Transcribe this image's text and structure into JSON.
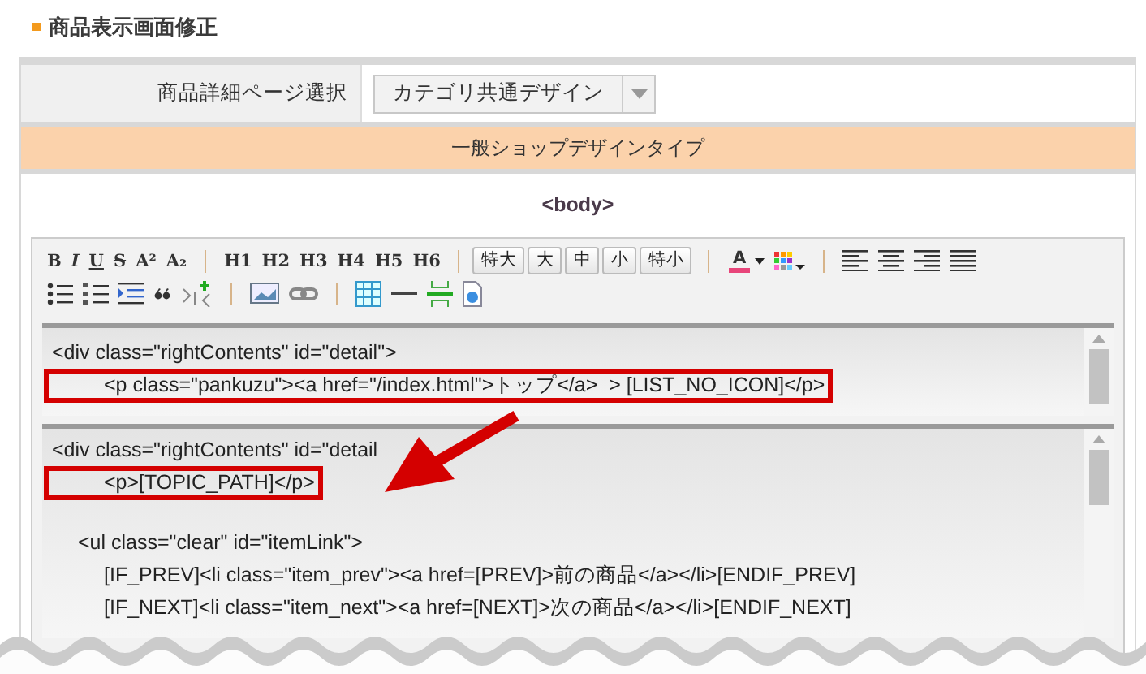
{
  "page_title": "商品表示画面修正",
  "detail_select": {
    "label": "商品詳細ページ選択",
    "value": "カテゴリ共通デザイン"
  },
  "design_type": "一般ショップデザインタイプ",
  "section_label": "<body>",
  "toolbar": {
    "format_buttons": [
      "B",
      "I",
      "U",
      "S",
      "A²",
      "A₂"
    ],
    "heading_buttons": [
      "H1",
      "H2",
      "H3",
      "H4",
      "H5",
      "H6"
    ],
    "size_buttons": [
      "特大",
      "大",
      "中",
      "小",
      "特小"
    ],
    "font_color_button": "A"
  },
  "code_panes": [
    {
      "blocks": [
        [
          {
            "text": "<div class=\"rightContents\" id=\"detail\">",
            "highlighted": false
          },
          {
            "text": "\t\t<p class=\"pankuzu\"><a href=\"/index.html\">トップ</a>  > [LIST_NO_ICON]</p>",
            "highlighted": true
          }
        ]
      ]
    },
    {
      "blocks": [
        [
          {
            "text": "<div class=\"rightContents\" id=\"detail",
            "highlighted": false
          },
          {
            "text": "\t\t<p>[TOPIC_PATH]</p>",
            "highlighted": true
          }
        ],
        [
          {
            "text": "\t<ul class=\"clear\" id=\"itemLink\">",
            "highlighted": false
          },
          {
            "text": "\t\t[IF_PREV]<li class=\"item_prev\"><a href=[PREV]>前の商品</a></li>[ENDIF_PREV]",
            "highlighted": false
          },
          {
            "text": "\t\t[IF_NEXT]<li class=\"item_next\"><a href=[NEXT]>次の商品</a></li>[ENDIF_NEXT]",
            "highlighted": false
          }
        ]
      ]
    }
  ]
}
